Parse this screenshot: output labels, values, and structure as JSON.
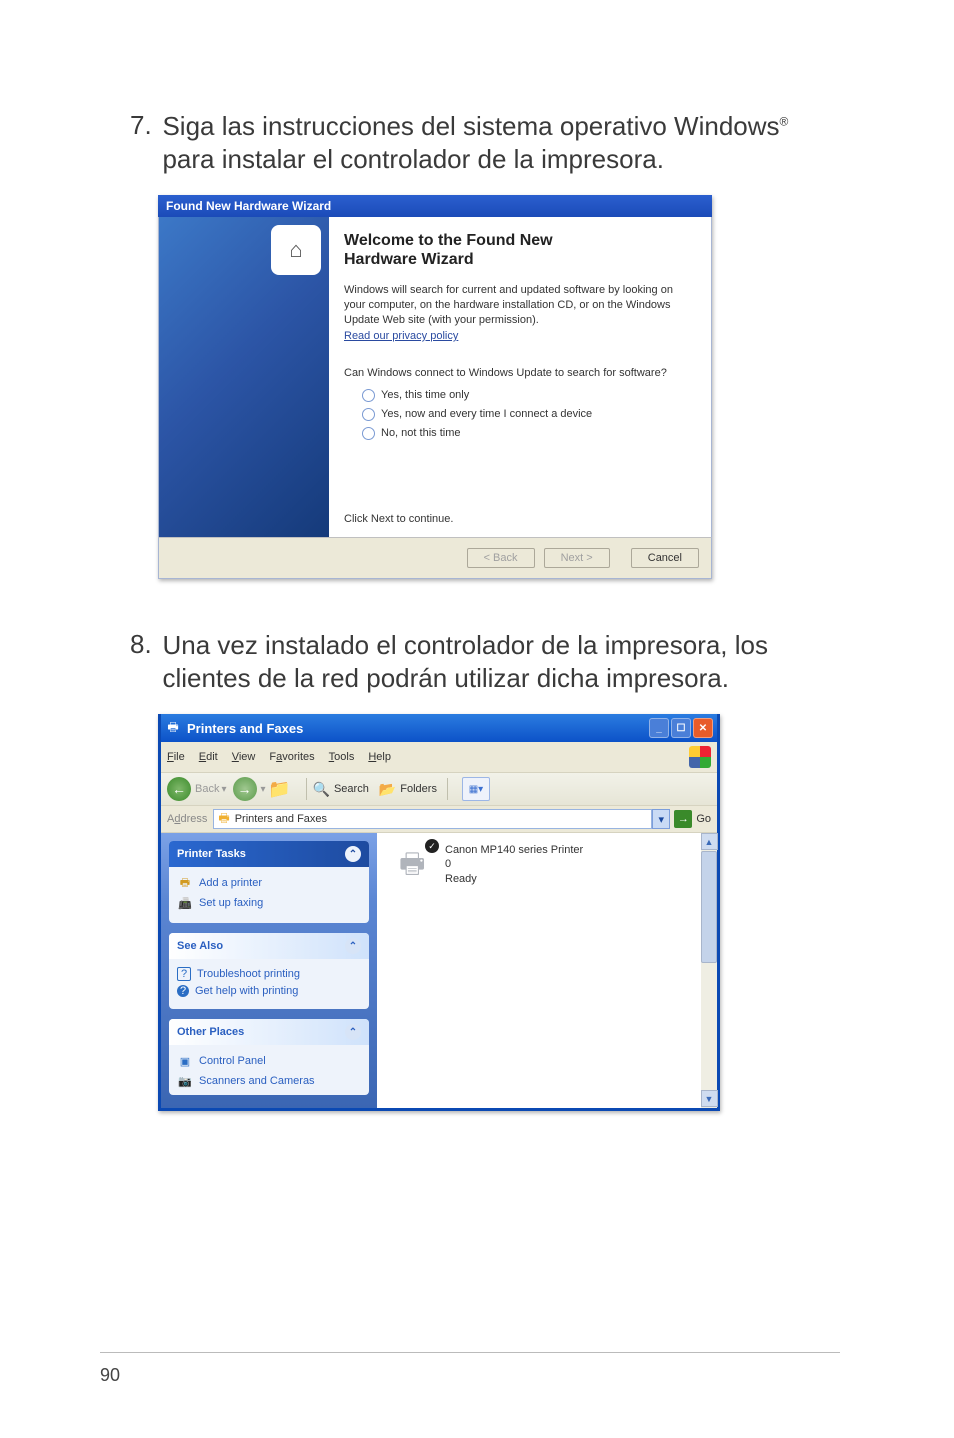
{
  "step7": {
    "num": "7.",
    "text_a": "Siga las instrucciones del sistema operativo Windows",
    "text_b": " para instalar el controlador de la impresora."
  },
  "wizard": {
    "title": "Found New Hardware Wizard",
    "heading_a": "Welcome to the Found New",
    "heading_b": "Hardware Wizard",
    "para": "Windows will search for current and updated software by looking on your computer, on the hardware installation CD, or on the Windows Update Web site (with your permission).",
    "privacy": "Read our privacy policy",
    "question": "Can Windows connect to Windows Update to search for software?",
    "opt1": "Yes, this time only",
    "opt2": "Yes, now and every time I connect a device",
    "opt3": "No, not this time",
    "click_next": "Click Next to continue.",
    "btn_back": "< Back",
    "btn_next": "Next >",
    "btn_cancel": "Cancel"
  },
  "step8": {
    "num": "8.",
    "text": "Una vez instalado el controlador de la impresora, los clientes de la red podrán utilizar dicha impresora."
  },
  "explorer": {
    "title": "Printers and Faxes",
    "menus": {
      "file": "File",
      "edit": "Edit",
      "view": "View",
      "fav": "Favorites",
      "tools": "Tools",
      "help": "Help"
    },
    "toolbar": {
      "back": "Back",
      "search": "Search",
      "folders": "Folders"
    },
    "address_label": "Address",
    "address_path": "Printers and Faxes",
    "go": "Go",
    "tasks": {
      "printer_tasks": "Printer Tasks",
      "add": "Add a printer",
      "fax": "Set up faxing",
      "see_also": "See Also",
      "troubleshoot": "Troubleshoot printing",
      "help": "Get help with printing",
      "other": "Other Places",
      "control": "Control Panel",
      "scanners": "Scanners and Cameras"
    },
    "printer": {
      "name": "Canon MP140 series Printer",
      "count": "0",
      "status": "Ready"
    }
  },
  "page_number": "90"
}
